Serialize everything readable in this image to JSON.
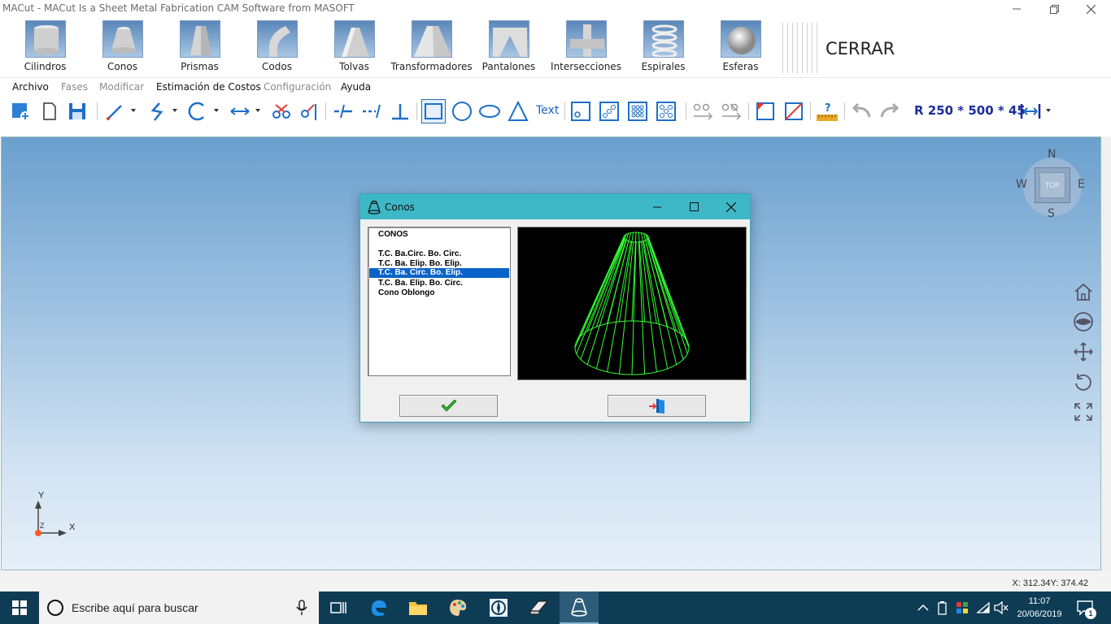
{
  "window": {
    "title": "MACut - MACut Is a Sheet Metal Fabrication CAM Software from MASOFT"
  },
  "ribbon": {
    "items": [
      {
        "label": "Cilindros",
        "icon": "cylinder-icon"
      },
      {
        "label": "Conos",
        "icon": "cone-icon"
      },
      {
        "label": "Prismas",
        "icon": "prism-icon"
      },
      {
        "label": "Codos",
        "icon": "elbow-icon"
      },
      {
        "label": "Tolvas",
        "icon": "hopper-icon"
      },
      {
        "label": "Transformadores",
        "icon": "transformer-icon"
      },
      {
        "label": "Pantalones",
        "icon": "trousers-icon"
      },
      {
        "label": "Intersecciones",
        "icon": "intersection-icon"
      },
      {
        "label": "Espirales",
        "icon": "spiral-icon"
      },
      {
        "label": "Esferas",
        "icon": "sphere-icon"
      }
    ],
    "close_label": "CERRAR"
  },
  "menu": {
    "items": [
      {
        "label": "Archivo",
        "enabled": true
      },
      {
        "label": "Fases",
        "enabled": false
      },
      {
        "label": "Modificar",
        "enabled": false
      },
      {
        "label": "Estimación de Costos",
        "enabled": true
      },
      {
        "label": "Configuración",
        "enabled": false
      },
      {
        "label": "Ayuda",
        "enabled": true
      }
    ]
  },
  "toolbar": {
    "text_tool_label": "Text",
    "dimension_readout": "R 250 * 500 * 45"
  },
  "navcube": {
    "north": "N",
    "south": "S",
    "east": "E",
    "west": "W",
    "face": "TOP"
  },
  "axis": {
    "x": "X",
    "y": "Y",
    "z": "Z"
  },
  "status": {
    "coordinates": "X: 312.34Y: 374.42"
  },
  "taskbar": {
    "search_placeholder": "Escribe aquí para buscar",
    "time": "11:07",
    "date": "20/06/2019",
    "notification_count": "1"
  },
  "dialog": {
    "title": "Conos",
    "list_header": "CONOS",
    "items": [
      "T.C. Ba.Circ. Bo. Circ.",
      "T.C. Ba. Elip. Bo. Elip.",
      "T.C. Ba. Circ. Bo. Elip.",
      "T.C. Ba. Elip. Bo. Circ.",
      "Cono Oblongo"
    ],
    "selected_index": 2,
    "preview_color": "#33ff33"
  },
  "colors": {
    "dialog_title": "#3eb7c6",
    "selection": "#0a63c9",
    "taskbar": "#0e3c55",
    "toolbar_accent": "#1c2c9c"
  }
}
